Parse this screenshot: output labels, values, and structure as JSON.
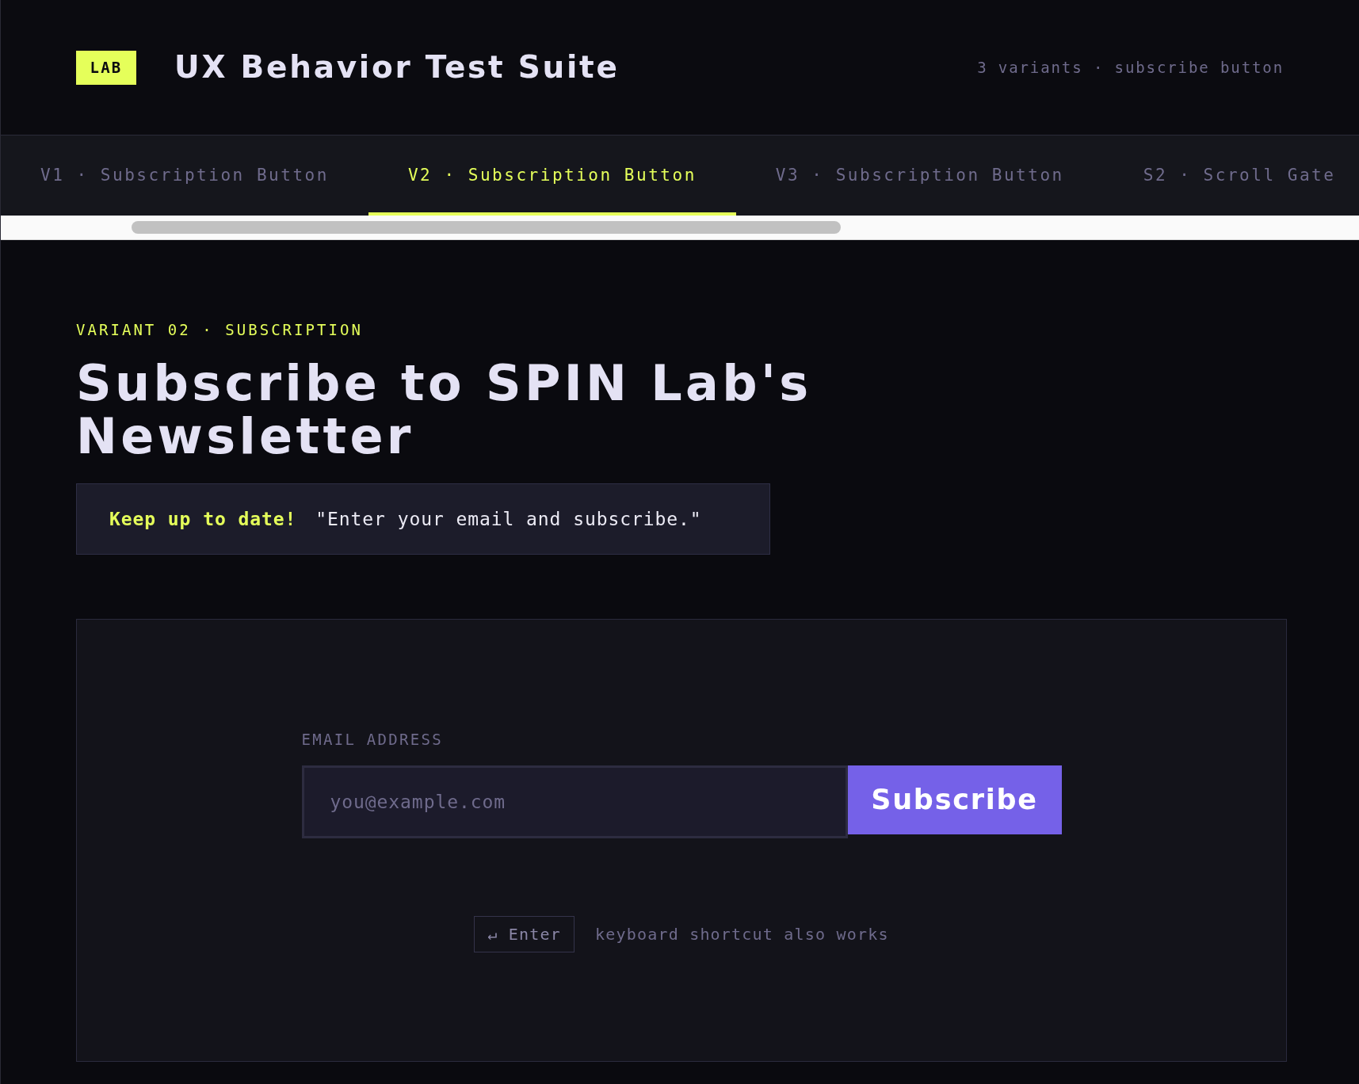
{
  "header": {
    "badge": "LAB",
    "title": "UX Behavior Test Suite",
    "meta": "3 variants · subscribe button"
  },
  "tabs": [
    {
      "label": "V1 · Subscription Button",
      "selected": false
    },
    {
      "label": "V2 · Subscription Button",
      "selected": true
    },
    {
      "label": "V3 · Subscription Button",
      "selected": false
    },
    {
      "label": "S2 · Scroll Gate",
      "selected": false
    }
  ],
  "eyebrow": "VARIANT 02 · SUBSCRIPTION",
  "heading": "Subscribe to SPIN Lab's Newsletter",
  "callout": {
    "lead": "Keep up to date!",
    "text": "\"Enter your email and subscribe.\""
  },
  "form": {
    "label": "EMAIL ADDRESS",
    "email": {
      "placeholder": "you@example.com"
    },
    "button": "Subscribe",
    "shortcut": {
      "key": "↵ Enter",
      "hint": "keyboard shortcut also works"
    }
  }
}
